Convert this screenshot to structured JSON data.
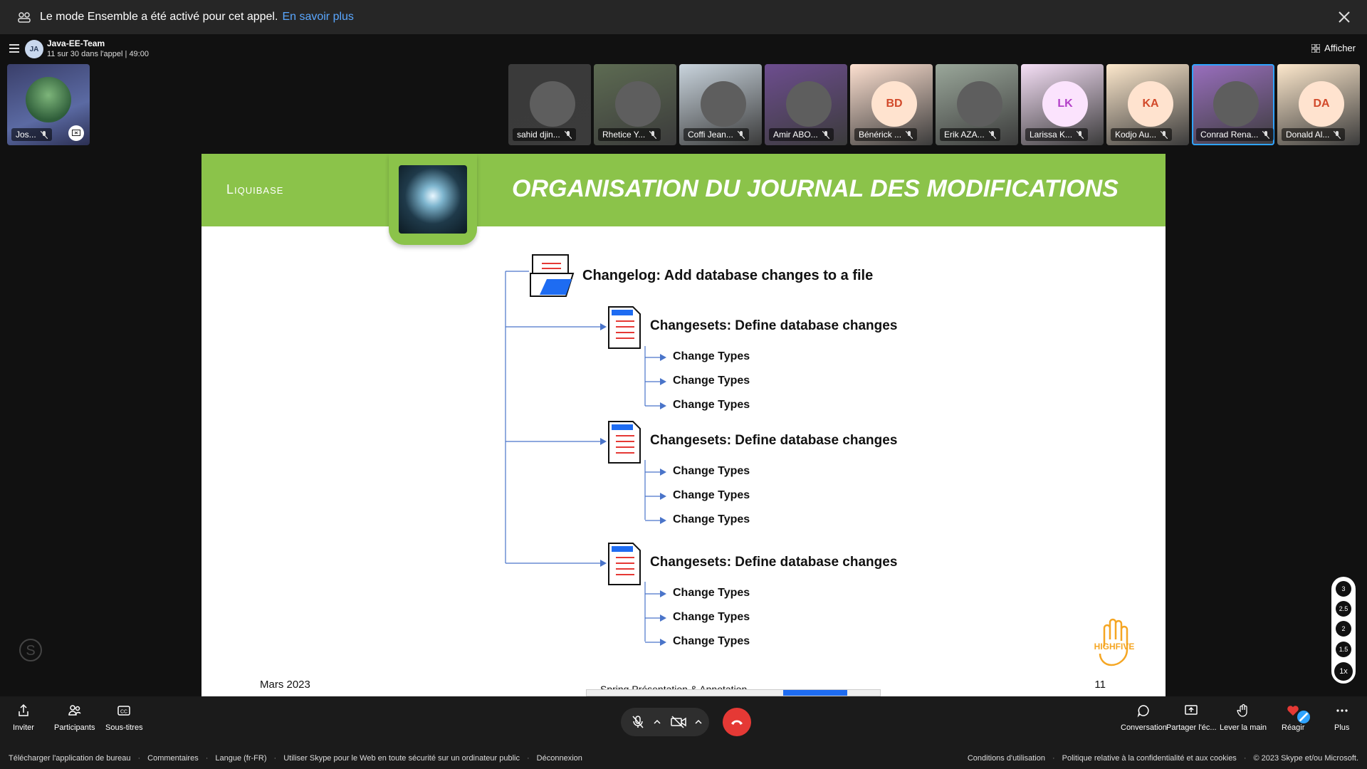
{
  "notice": {
    "text": "Le mode Ensemble a été activé pour cet appel.",
    "link": "En savoir plus"
  },
  "header": {
    "group_initials": "JA",
    "group_name": "Java-EE-Team",
    "status": "11 sur 30 dans l'appel | 49:00",
    "afficher": "Afficher"
  },
  "self_tile": {
    "name": "Jos..."
  },
  "participants": [
    {
      "name": "sahid djin...",
      "initials": "",
      "color": "#3a3a3a"
    },
    {
      "name": "Rhetice Y...",
      "initials": "",
      "color": "#5d6b52"
    },
    {
      "name": "Coffi Jean...",
      "initials": "",
      "color": "#c9d4dd"
    },
    {
      "name": "Amir ABO...",
      "initials": "",
      "color": "#6d4d8f"
    },
    {
      "name": "Bénérick ...",
      "initials": "BD",
      "color": "#fde0d0"
    },
    {
      "name": "Erik AZA...",
      "initials": "",
      "color": "#9aa79a"
    },
    {
      "name": "Larissa K...",
      "initials": "LK",
      "color": "#f5dff6"
    },
    {
      "name": "Kodjo Au...",
      "initials": "KA",
      "color": "#fde8cc"
    },
    {
      "name": "Conrad Rena...",
      "initials": "",
      "color": "#9a6fbf"
    },
    {
      "name": "Donald Al...",
      "initials": "DA",
      "color": "#fde8cc"
    }
  ],
  "slide": {
    "brand": "Liquibase",
    "title": "ORGANISATION DU JOURNAL DES MODIFICATIONS",
    "changelog": "Changelog: Add database changes to a file",
    "changeset": "Changesets: Define database changes",
    "change_type": "Change Types",
    "date": "Mars 2023",
    "center_footer": "Spring Présentation & Annotation",
    "page": "11",
    "logo_text": "HIGHFIVE"
  },
  "zoom": [
    "3",
    "2.5",
    "2",
    "1.5",
    "1x"
  ],
  "toolbar": {
    "inviter": "Inviter",
    "participants": "Participants",
    "sous_titres": "Sous-titres",
    "conversation": "Conversation",
    "partager": "Partager l'éc...",
    "lever": "Lever la main",
    "reagir": "Réagir",
    "plus": "Plus"
  },
  "footer": {
    "left": [
      "Télécharger l'application de bureau",
      "Commentaires",
      "Langue (fr-FR)",
      "Utiliser Skype pour le Web en toute sécurité sur un ordinateur public",
      "Déconnexion"
    ],
    "right": [
      "Conditions d'utilisation",
      "Politique relative à la confidentialité et aux cookies",
      "© 2023 Skype et/ou Microsoft."
    ]
  }
}
